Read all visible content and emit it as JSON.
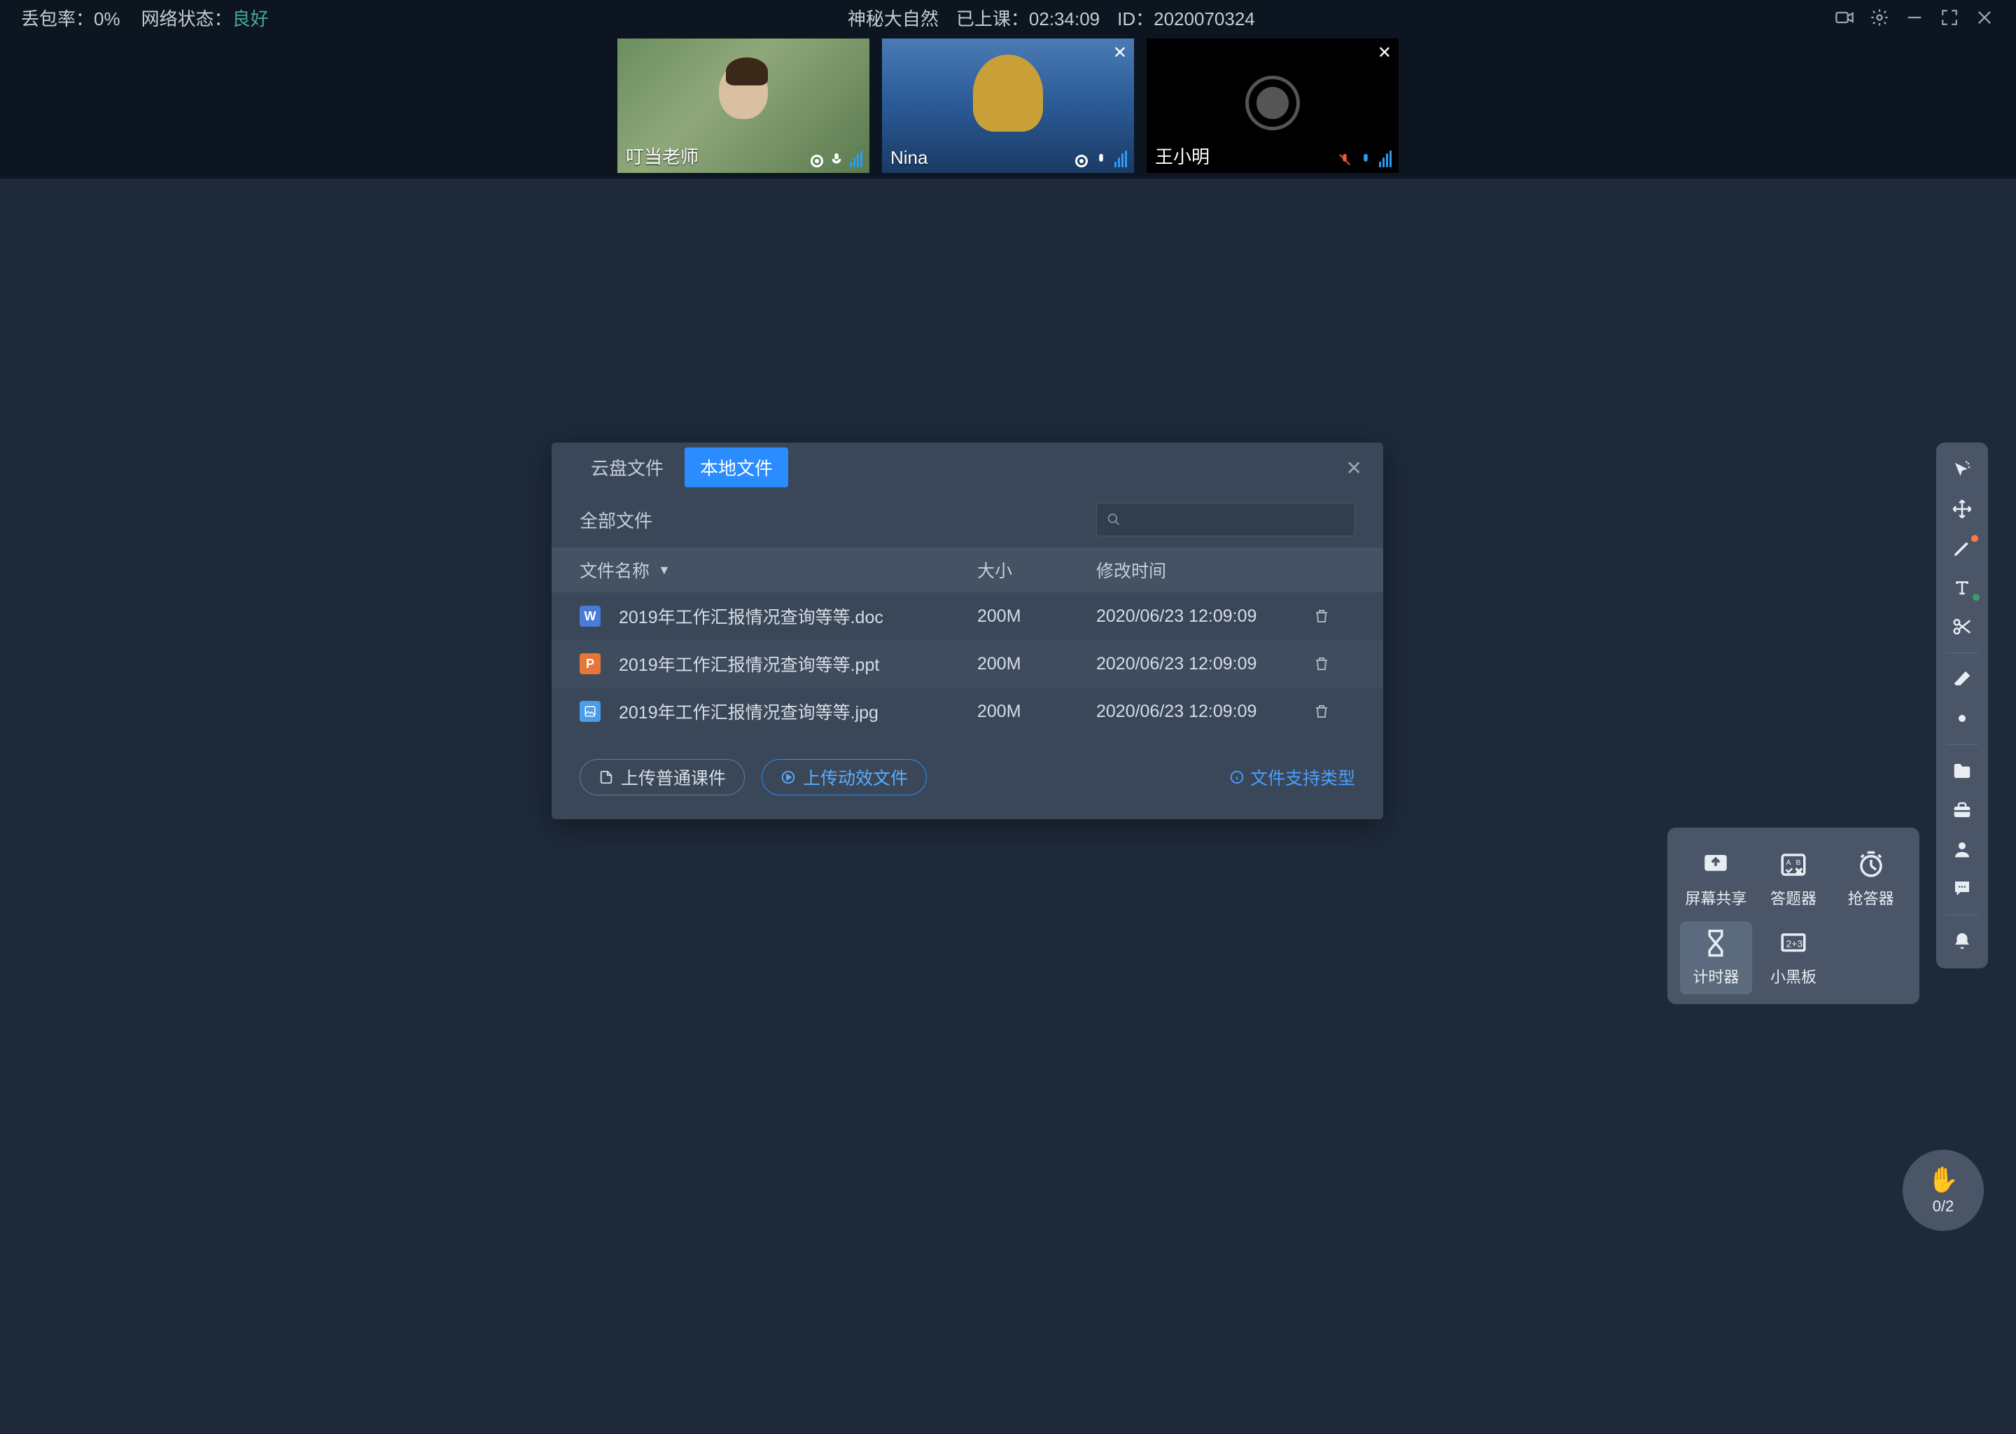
{
  "status": {
    "packet_loss_label": "丢包率：",
    "packet_loss_value": "0%",
    "network_label": "网络状态：",
    "network_value": "良好",
    "room_title": "神秘大自然",
    "elapsed_label": "已上课：",
    "elapsed_value": "02:34:09",
    "id_label": "ID：",
    "id_value": "2020070324"
  },
  "videos": [
    {
      "name": "叮当老师",
      "closable": false,
      "camera_off": false
    },
    {
      "name": "Nina",
      "closable": true,
      "camera_off": false
    },
    {
      "name": "王小明",
      "closable": true,
      "camera_off": true
    }
  ],
  "dialog": {
    "tabs": {
      "cloud": "云盘文件",
      "local": "本地文件"
    },
    "filter_label": "全部文件",
    "columns": {
      "name": "文件名称",
      "size": "大小",
      "date": "修改时间"
    },
    "files": [
      {
        "icon": "W",
        "type": "doc",
        "name": "2019年工作汇报情况查询等等.doc",
        "size": "200M",
        "date": "2020/06/23 12:09:09"
      },
      {
        "icon": "P",
        "type": "ppt",
        "name": "2019年工作汇报情况查询等等.ppt",
        "size": "200M",
        "date": "2020/06/23 12:09:09"
      },
      {
        "icon": "▲",
        "type": "img",
        "name": "2019年工作汇报情况查询等等.jpg",
        "size": "200M",
        "date": "2020/06/23 12:09:09"
      }
    ],
    "upload_normal": "上传普通课件",
    "upload_dynamic": "上传动效文件",
    "support_link": "文件支持类型"
  },
  "tool_popup": {
    "screen_share": "屏幕共享",
    "answer_tool": "答题器",
    "buzzer": "抢答器",
    "timer": "计时器",
    "blackboard": "小黑板"
  },
  "raise_hand": {
    "count": "0/2"
  },
  "sort_arrow": "▼"
}
